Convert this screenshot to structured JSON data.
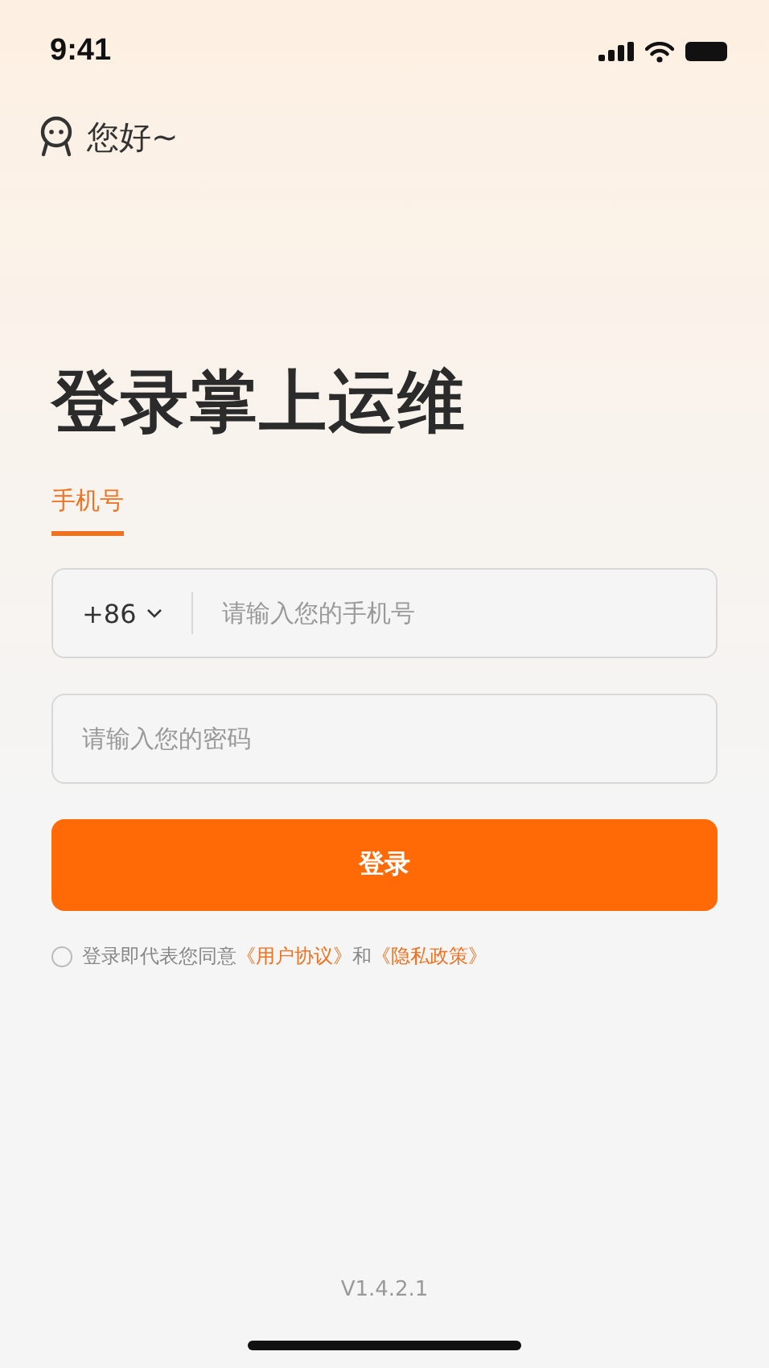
{
  "status_bar": {
    "time": "9:41"
  },
  "greeting": "您好~",
  "title": "登录掌上运维",
  "tabs": [
    {
      "label": "手机号",
      "selected": true
    }
  ],
  "phone_field": {
    "country_code": "+86",
    "placeholder": "请输入您的手机号"
  },
  "password_field": {
    "placeholder": "请输入您的密码"
  },
  "login_button": "登录",
  "agreement": {
    "checked": false,
    "text": "登录即代表您同意",
    "link_1": "《用户协议》",
    "joiner": "和",
    "link_2": "《隐私政策》"
  },
  "version": "V1.4.2.1"
}
